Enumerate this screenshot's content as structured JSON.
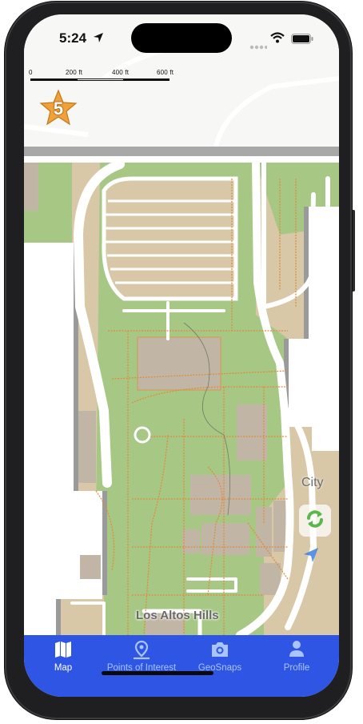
{
  "status_bar": {
    "time": "5:24"
  },
  "map": {
    "scale": {
      "labels": [
        "0",
        "200 ft",
        "400 ft",
        "600 ft"
      ]
    },
    "level_badge": "5",
    "place_label": "Los Altos Hills",
    "city_label": "City",
    "colors": {
      "background": "#f7f7f5",
      "green": "#a7c785",
      "tan": "#d8c8a8",
      "building": "#c1b6a5",
      "road": "#ffffff",
      "path": "#e08d3c"
    }
  },
  "tabbar": {
    "color": "#2f55e4",
    "tabs": [
      {
        "label": "Map",
        "icon": "map-icon",
        "active": true
      },
      {
        "label": "Points of Interest",
        "icon": "location-pin-icon",
        "active": false
      },
      {
        "label": "GeoSnaps",
        "icon": "camera-icon",
        "active": false
      },
      {
        "label": "Profile",
        "icon": "person-icon",
        "active": false
      }
    ]
  }
}
